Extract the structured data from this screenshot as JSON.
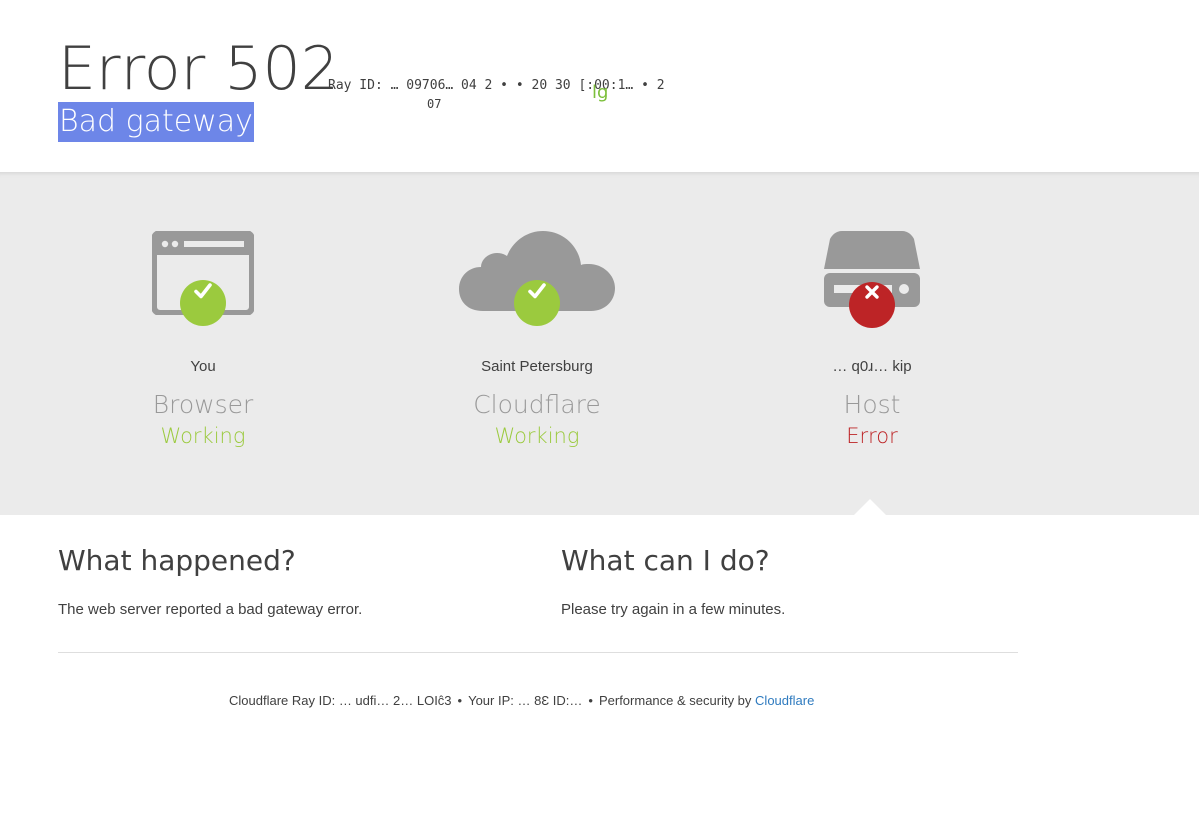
{
  "header": {
    "error_code": "Error 502",
    "ray_line": "Ray ID: … 09706… 04  2 • • 20     30 [:00:1…  • 2",
    "ray_line_2": "07",
    "ray_green": "lg",
    "subtitle": "Bad gateway"
  },
  "status": {
    "browser": {
      "location": "You",
      "component": "Browser",
      "state": "Working",
      "icon": "browser-window-icon",
      "badge": "check-icon"
    },
    "cloudflare": {
      "location": "Saint Petersburg",
      "component": "Cloudflare",
      "state": "Working",
      "icon": "cloud-icon",
      "badge": "check-icon"
    },
    "host": {
      "location": "… q0ɹ… kip",
      "component": "Host",
      "state": "Error",
      "icon": "server-drive-icon",
      "badge": "x-icon"
    },
    "colors": {
      "ok": "#9bca3e",
      "error": "#bd2426",
      "icon_gray": "#999999"
    }
  },
  "info": {
    "what_happened_title": "What happened?",
    "what_happened_text": "The web server reported a bad gateway error.",
    "what_can_i_do_title": "What can I do?",
    "what_can_i_do_text": "Please try again in a few minutes."
  },
  "footer": {
    "ray_label": "Cloudflare Ray ID: … udfi… 2… LOIĉ3",
    "ip_label": "Your IP: … 8Ɛ ID:…",
    "perf_label": "Performance & security by",
    "perf_link": "Cloudflare",
    "separator": "•",
    "link_color": "#2f7bbf"
  }
}
